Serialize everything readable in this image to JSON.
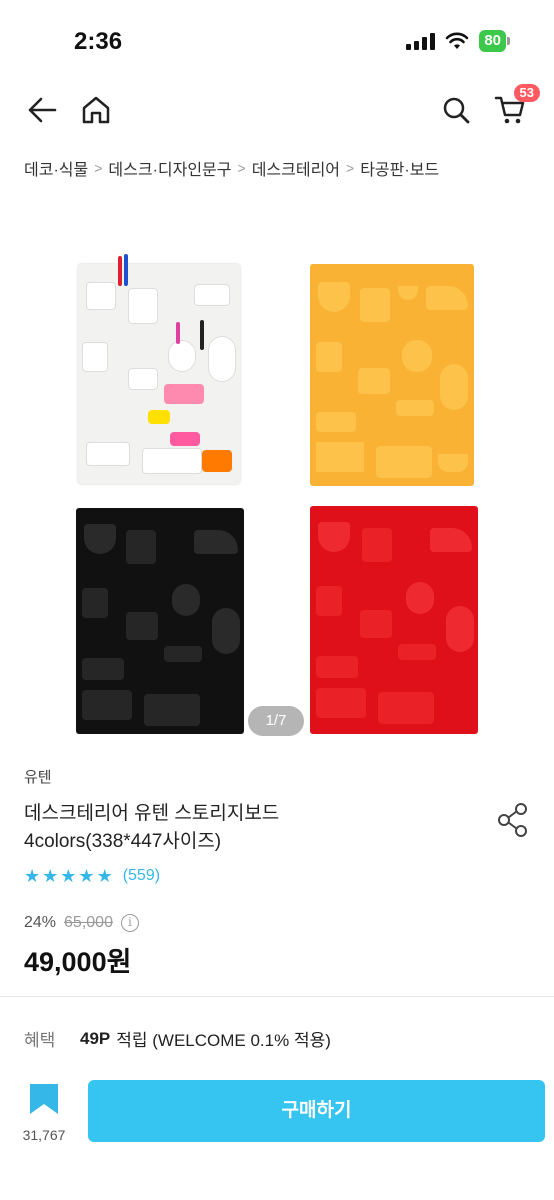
{
  "status": {
    "time": "2:36",
    "battery": "80"
  },
  "nav": {
    "cart_count": "53"
  },
  "breadcrumb": [
    "데코·식물",
    "데스크·디자인문구",
    "데스크테리어",
    "타공판·보드"
  ],
  "gallery": {
    "page_indicator": "1/7",
    "board_colors": [
      "#f2f2f0",
      "#f9b233",
      "#111111",
      "#e0101a"
    ]
  },
  "product": {
    "brand": "유텐",
    "title_line1": "데스크테리어 유텐 스토리지보드",
    "title_line2": "4colors(338*447사이즈)",
    "rating_stars": 5,
    "review_count": "(559)",
    "discount": "24%",
    "original_price": "65,000",
    "price": "49,000원"
  },
  "benefit": {
    "label": "혜택",
    "points": "49P",
    "text": "적립 (WELCOME 0.1% 적용)"
  },
  "bottom": {
    "bookmark_count": "31,767",
    "buy_label": "구매하기"
  },
  "colors": {
    "accent": "#35c5f0",
    "star": "#35b7e8",
    "badge": "#ff5a61"
  }
}
